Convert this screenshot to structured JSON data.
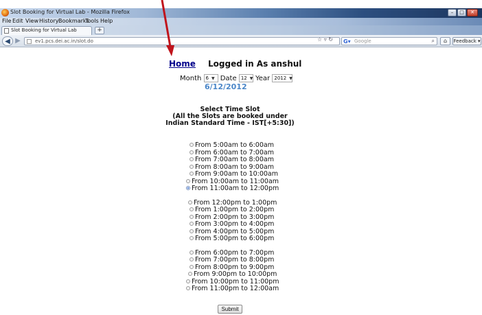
{
  "browser": {
    "window_title": "Slot Booking for Virtual Lab - Mozilla Firefox",
    "menu": [
      "File",
      "Edit",
      "View",
      "History",
      "Bookmarks",
      "Tools",
      "Help"
    ],
    "tab_label": "Slot Booking for Virtual Lab",
    "new_tab": "+",
    "url": "ev1.pcs.dei.ac.in/slot.do",
    "search_placeholder": "Google",
    "feedback_label": "Feedback"
  },
  "page": {
    "home_link": "Home",
    "logged_in": "Logged in As anshul",
    "month_label": "Month",
    "month_value": "6",
    "date_label": "Date",
    "date_value": "12",
    "year_label": "Year",
    "year_value": "2012",
    "selected_date": "6/12/2012",
    "heading_line1": "Select Time Slot",
    "heading_line2": "(All the Slots are booked under",
    "heading_line3": "Indian Standard Time - IST[+5:30])",
    "slots": [
      {
        "label": "From 5:00am to 6:00am",
        "checked": false
      },
      {
        "label": "From 6:00am to 7:00am",
        "checked": false
      },
      {
        "label": "From 7:00am to 8:00am",
        "checked": false
      },
      {
        "label": "From 8:00am to 9:00am",
        "checked": false
      },
      {
        "label": "From 9:00am to 10:00am",
        "checked": false
      },
      {
        "label": "From 10:00am to 11:00am",
        "checked": false
      },
      {
        "label": "From 11:00am to 12:00pm",
        "checked": true
      },
      {
        "label": "From 12:00pm to 1:00pm",
        "checked": false
      },
      {
        "label": "From 1:00pm to 2:00pm",
        "checked": false
      },
      {
        "label": "From 2:00pm to 3:00pm",
        "checked": false
      },
      {
        "label": "From 3:00pm to 4:00pm",
        "checked": false
      },
      {
        "label": "From 4:00pm to 5:00pm",
        "checked": false
      },
      {
        "label": "From 5:00pm to 6:00pm",
        "checked": false
      },
      {
        "label": "From 6:00pm to 7:00pm",
        "checked": false
      },
      {
        "label": "From 7:00pm to 8:00pm",
        "checked": false
      },
      {
        "label": "From 8:00pm to 9:00pm",
        "checked": false
      },
      {
        "label": "From 9:00pm to 10:00pm",
        "checked": false
      },
      {
        "label": "From 10:00pm to 11:00pm",
        "checked": false
      },
      {
        "label": "From 11:00pm to 12:00am",
        "checked": false
      }
    ],
    "submit_label": "Submit"
  },
  "colors": {
    "home_link": "#00008b",
    "selected_date": "#4a86c8",
    "annotation_arrow": "#c0141c"
  },
  "icons": [
    "firefox-icon",
    "back-icon",
    "forward-icon",
    "home-icon",
    "search-icon",
    "annotation-arrow"
  ]
}
